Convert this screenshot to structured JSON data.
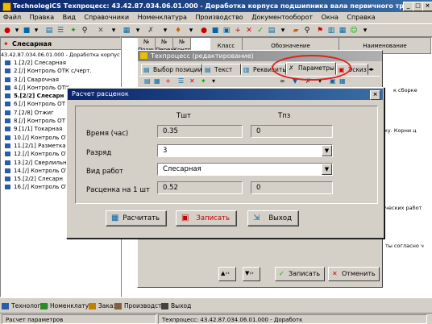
{
  "app": {
    "title": "TechnologiCS Техпроцесс: 43.42.87.034.06.01.000 - Доработка корпуса подшипника вала первичного трансмиссии дизеля",
    "window_buttons": [
      "_",
      "□",
      "×"
    ]
  },
  "menu": [
    "Файл",
    "Правка",
    "Вид",
    "Справочники",
    "Номенклатура",
    "Производство",
    "Документооборот",
    "Окна",
    "Справка"
  ],
  "left_panel": {
    "header": "Слесарная",
    "path": "43.42.87.034.06.01.000 - Доработка корпус",
    "items": [
      {
        "label": "1.[2/2] Слесарная",
        "bold": false
      },
      {
        "label": "2.[/] Контроль ОТК с/черт.",
        "bold": false
      },
      {
        "label": "3.[/] Сварочная",
        "bold": false
      },
      {
        "label": "4.[/] Контроль ОТК",
        "bold": false
      },
      {
        "label": "5.[2/2] Слесарн",
        "bold": true
      },
      {
        "label": "6.[/] Контроль ОТ",
        "bold": false
      },
      {
        "label": "7.[2/8] Отжиг",
        "bold": false
      },
      {
        "label": "8.[/] Контроль ОТ",
        "bold": false
      },
      {
        "label": "9.[1/1] Токарная",
        "bold": false
      },
      {
        "label": "10.[/] Контроль ОТ",
        "bold": false
      },
      {
        "label": "11.[2/1] Разметка",
        "bold": false
      },
      {
        "label": "12.[/] Контроль ОТ",
        "bold": false
      },
      {
        "label": "13.[2/] Сверлильн",
        "bold": false
      },
      {
        "label": "14.[/] Контроль ОТ",
        "bold": false
      },
      {
        "label": "15.[2/2] Слесарн",
        "bold": false
      },
      {
        "label": "16.[/] Контроль ОТ",
        "bold": false
      }
    ]
  },
  "grid": {
    "headers": [
      "№ Позиции",
      "№ Перехода",
      "№ Контроля",
      "Класс",
      "Обозначение",
      "Наименование"
    ],
    "snippets": [
      "к сборке",
      "ку. Корни ц",
      "ческих работ",
      "ты согласно ч"
    ]
  },
  "tp_window": {
    "title": "Техпроцесс (редактирование)",
    "tabs": [
      "Выбор позиции",
      "Текст",
      "Реквизиты",
      "Параметры",
      "Эскиз"
    ],
    "buttons": {
      "save": "Записать",
      "cancel": "Отменить"
    }
  },
  "dialog": {
    "title": "Расчет расценок",
    "col_headers": [
      "Тшт",
      "Тпз"
    ],
    "rows": {
      "time": {
        "label": "Время (час)",
        "tsht": "0.35",
        "tpz": "0"
      },
      "grade": {
        "label": "Разряд",
        "value": "3"
      },
      "work_type": {
        "label": "Вид работ",
        "value": "Слесарная"
      },
      "rate": {
        "label": "Расценка на 1 шт",
        "tsht": "0.52",
        "tpz": "0"
      }
    },
    "buttons": {
      "calc": "Расчитать",
      "save": "Записать",
      "exit": "Выход"
    }
  },
  "bottom_bar": [
    "Технология",
    "Номенклатура",
    "Заказы",
    "Производство",
    "Выход"
  ],
  "status": {
    "left": "Расчет параметров",
    "right": "Техпроцесс: 43.42.87.034.06.01.000 - Доработк"
  },
  "colors": {
    "title_bar": "#0a246a",
    "highlight_ellipse": "#e02020",
    "save_text": "#cc0000"
  }
}
